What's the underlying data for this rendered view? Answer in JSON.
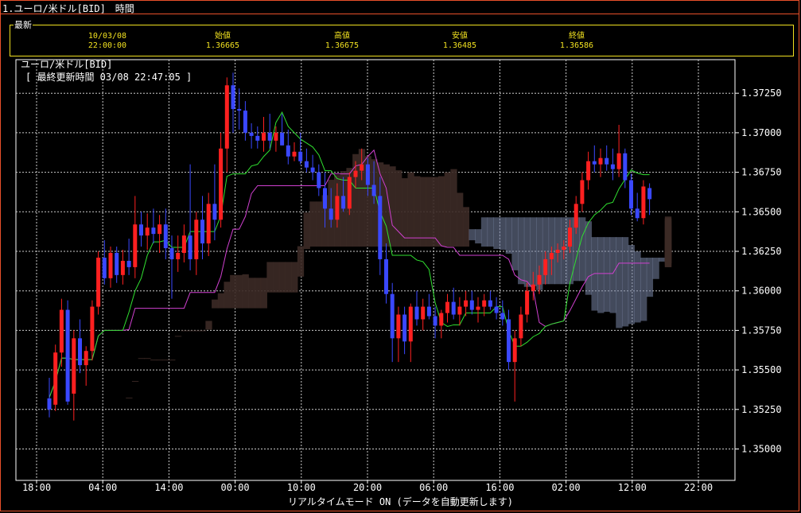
{
  "window": {
    "title": "1.ユーロ/米ドル[BID]　時間"
  },
  "quote": {
    "legend": "最新",
    "date": "10/03/08",
    "time": "22:00:00",
    "open_label": "始値",
    "open": "1.36665",
    "high_label": "高値",
    "high": "1.36675",
    "low_label": "安値",
    "low": "1.36485",
    "close_label": "終値",
    "close": "1.36586"
  },
  "chart_title": "ユーロ/米ドル[BID]",
  "chart_subtitle": "[ 最終更新時間 03/08 22:47:05 ]",
  "footer": "リアルタイムモード ON (データを自動更新します)",
  "colors": {
    "up": "#ff2020",
    "down": "#3a48ff",
    "tenkan": "#30e030",
    "kijun": "#d040d0",
    "cloud_bear": "#7a86a8",
    "cloud_bull": "#3c2a26",
    "grid": "#cccccc"
  },
  "chart_data": {
    "type": "candlestick",
    "title": "ユーロ/米ドル[BID]",
    "x_tick_labels": [
      "18:00",
      "04:00",
      "14:00",
      "00:00",
      "10:00",
      "20:00",
      "06:00",
      "16:00",
      "02:00",
      "12:00",
      "22:00"
    ],
    "y_tick_labels": [
      "1.35000",
      "1.35250",
      "1.35500",
      "1.35750",
      "1.36000",
      "1.36250",
      "1.36500",
      "1.36750",
      "1.37000",
      "1.37250"
    ],
    "ylim": [
      1.3485,
      1.3765
    ],
    "grid": true,
    "candles_ohlc": [
      [
        1.3532,
        1.3545,
        1.352,
        1.3525
      ],
      [
        1.3528,
        1.3566,
        1.3524,
        1.3561
      ],
      [
        1.3561,
        1.3595,
        1.3552,
        1.3588
      ],
      [
        1.3588,
        1.3594,
        1.3528,
        1.353
      ],
      [
        1.3535,
        1.3575,
        1.3518,
        1.357
      ],
      [
        1.357,
        1.3582,
        1.3548,
        1.3553
      ],
      [
        1.3553,
        1.3565,
        1.354,
        1.3562
      ],
      [
        1.3562,
        1.3594,
        1.3556,
        1.359
      ],
      [
        1.359,
        1.3625,
        1.3585,
        1.3621
      ],
      [
        1.3621,
        1.3632,
        1.3604,
        1.3608
      ],
      [
        1.3608,
        1.3628,
        1.3602,
        1.3624
      ],
      [
        1.3624,
        1.3628,
        1.3605,
        1.361
      ],
      [
        1.361,
        1.3626,
        1.3604,
        1.3619
      ],
      [
        1.3619,
        1.3633,
        1.361,
        1.3615
      ],
      [
        1.3615,
        1.366,
        1.3608,
        1.3642
      ],
      [
        1.3642,
        1.365,
        1.3628,
        1.3635
      ],
      [
        1.3635,
        1.3649,
        1.3626,
        1.364
      ],
      [
        1.364,
        1.3652,
        1.363,
        1.3636
      ],
      [
        1.3636,
        1.3648,
        1.3624,
        1.3642
      ],
      [
        1.3642,
        1.3652,
        1.362,
        1.3627
      ],
      [
        1.3627,
        1.3635,
        1.3595,
        1.362
      ],
      [
        1.362,
        1.3635,
        1.3612,
        1.3624
      ],
      [
        1.3624,
        1.3642,
        1.3618,
        1.3635
      ],
      [
        1.3635,
        1.368,
        1.3613,
        1.362
      ],
      [
        1.362,
        1.365,
        1.361,
        1.3645
      ],
      [
        1.3645,
        1.366,
        1.362,
        1.363
      ],
      [
        1.363,
        1.3662,
        1.3622,
        1.3655
      ],
      [
        1.3655,
        1.368,
        1.3632,
        1.3645
      ],
      [
        1.3645,
        1.37,
        1.364,
        1.369
      ],
      [
        1.369,
        1.3735,
        1.3675,
        1.373
      ],
      [
        1.373,
        1.3738,
        1.37,
        1.3715
      ],
      [
        1.3715,
        1.3728,
        1.3702,
        1.3714
      ],
      [
        1.3714,
        1.372,
        1.3695,
        1.37
      ],
      [
        1.37,
        1.3706,
        1.369,
        1.3698
      ],
      [
        1.3698,
        1.3704,
        1.369,
        1.3695
      ],
      [
        1.3695,
        1.371,
        1.3688,
        1.37
      ],
      [
        1.37,
        1.3712,
        1.369,
        1.3695
      ],
      [
        1.3695,
        1.3704,
        1.3688,
        1.37
      ],
      [
        1.37,
        1.3712,
        1.3692,
        1.3692
      ],
      [
        1.3692,
        1.3702,
        1.368,
        1.3685
      ],
      [
        1.3685,
        1.3694,
        1.3682,
        1.3688
      ],
      [
        1.3688,
        1.37,
        1.368,
        1.3682
      ],
      [
        1.3682,
        1.369,
        1.3675,
        1.3678
      ],
      [
        1.3678,
        1.3686,
        1.367,
        1.3675
      ],
      [
        1.3675,
        1.368,
        1.366,
        1.3665
      ],
      [
        1.3665,
        1.3675,
        1.364,
        1.3652
      ],
      [
        1.3652,
        1.3665,
        1.364,
        1.3645
      ],
      [
        1.3645,
        1.3668,
        1.364,
        1.366
      ],
      [
        1.366,
        1.3672,
        1.365,
        1.3652
      ],
      [
        1.3652,
        1.3675,
        1.3648,
        1.3672
      ],
      [
        1.3672,
        1.3682,
        1.3665,
        1.3676
      ],
      [
        1.3676,
        1.369,
        1.367,
        1.368
      ],
      [
        1.368,
        1.3684,
        1.366,
        1.3667
      ],
      [
        1.3667,
        1.3682,
        1.3655,
        1.366
      ],
      [
        1.366,
        1.3672,
        1.361,
        1.362
      ],
      [
        1.362,
        1.363,
        1.3592,
        1.3598
      ],
      [
        1.3598,
        1.3605,
        1.3555,
        1.357
      ],
      [
        1.357,
        1.359,
        1.3555,
        1.3585
      ],
      [
        1.3585,
        1.359,
        1.356,
        1.3568
      ],
      [
        1.3568,
        1.3592,
        1.3555,
        1.359
      ],
      [
        1.359,
        1.36,
        1.3578,
        1.3582
      ],
      [
        1.3582,
        1.3595,
        1.3575,
        1.359
      ],
      [
        1.359,
        1.3598,
        1.3582,
        1.3584
      ],
      [
        1.3584,
        1.359,
        1.357,
        1.3578
      ],
      [
        1.3578,
        1.3588,
        1.357,
        1.3586
      ],
      [
        1.3586,
        1.3598,
        1.358,
        1.3593
      ],
      [
        1.3593,
        1.3602,
        1.3582,
        1.3585
      ],
      [
        1.3585,
        1.3596,
        1.3578,
        1.359
      ],
      [
        1.359,
        1.36,
        1.3584,
        1.3594
      ],
      [
        1.3594,
        1.36,
        1.3585,
        1.3588
      ],
      [
        1.3588,
        1.3596,
        1.358,
        1.359
      ],
      [
        1.359,
        1.3598,
        1.3584,
        1.3594
      ],
      [
        1.3594,
        1.36,
        1.3588,
        1.359
      ],
      [
        1.359,
        1.3596,
        1.3582,
        1.3586
      ],
      [
        1.3586,
        1.3594,
        1.3578,
        1.3582
      ],
      [
        1.3582,
        1.3588,
        1.355,
        1.3555
      ],
      [
        1.3555,
        1.3575,
        1.353,
        1.357
      ],
      [
        1.357,
        1.359,
        1.3565,
        1.3585
      ],
      [
        1.3585,
        1.3605,
        1.358,
        1.36
      ],
      [
        1.36,
        1.3612,
        1.3594,
        1.3604
      ],
      [
        1.3604,
        1.3616,
        1.3598,
        1.361
      ],
      [
        1.361,
        1.3625,
        1.3604,
        1.362
      ],
      [
        1.362,
        1.3628,
        1.361,
        1.3624
      ],
      [
        1.3624,
        1.363,
        1.3618,
        1.3626
      ],
      [
        1.3626,
        1.3632,
        1.362,
        1.3628
      ],
      [
        1.3628,
        1.3645,
        1.3624,
        1.364
      ],
      [
        1.364,
        1.366,
        1.3636,
        1.3655
      ],
      [
        1.3655,
        1.3675,
        1.365,
        1.367
      ],
      [
        1.367,
        1.3688,
        1.3664,
        1.3682
      ],
      [
        1.3682,
        1.3692,
        1.3675,
        1.368
      ],
      [
        1.368,
        1.369,
        1.3672,
        1.3684
      ],
      [
        1.3684,
        1.3692,
        1.3676,
        1.368
      ],
      [
        1.368,
        1.369,
        1.367,
        1.3677
      ],
      [
        1.3677,
        1.3705,
        1.3672,
        1.3687
      ],
      [
        1.3687,
        1.369,
        1.3665,
        1.367
      ],
      [
        1.367,
        1.3674,
        1.3648,
        1.3652
      ],
      [
        1.3652,
        1.3662,
        1.3644,
        1.3646
      ],
      [
        1.3646,
        1.367,
        1.3642,
        1.3666
      ],
      [
        1.3665,
        1.3668,
        1.3648,
        1.3658
      ]
    ]
  }
}
